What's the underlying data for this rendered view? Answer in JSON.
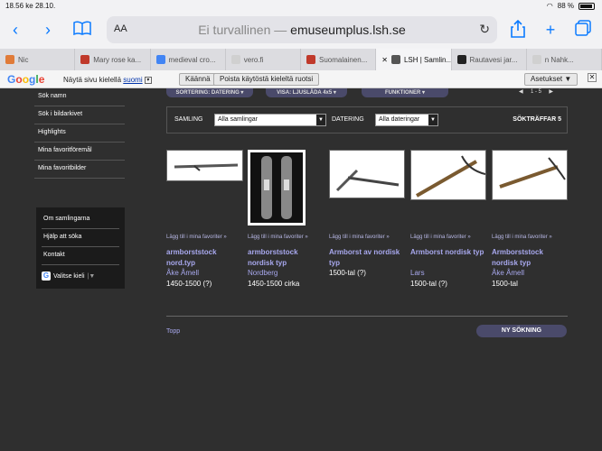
{
  "status": {
    "time": "18.56",
    "date": "ke 28.10.",
    "battery": "88 %"
  },
  "browser": {
    "aa": "AA",
    "insecure": "Ei turvallinen",
    "separator": " — ",
    "domain": "emuseumplus.lsh.se",
    "tabs": [
      {
        "label": "Nic",
        "color": "#e07b39"
      },
      {
        "label": "Mary rose ka...",
        "color": "#c0392b"
      },
      {
        "label": "medieval cro...",
        "color": "#4285f4"
      },
      {
        "label": "vero.fi",
        "color": "#d0d0d0"
      },
      {
        "label": "Suomalainen...",
        "color": "#c0392b"
      },
      {
        "label": "LSH | Samlin...",
        "color": "#555555",
        "active": true
      },
      {
        "label": "Rautavesi jar...",
        "color": "#222222"
      },
      {
        "label": "n Nahk...",
        "color": "#d0d0d0"
      }
    ]
  },
  "translate": {
    "logo": "Google",
    "prompt": "Näytä sivu kielellä",
    "language": "suomi",
    "translate_btn": "Käännä",
    "never_btn": "Poista käytöstä kieleltä ruotsi",
    "settings_btn": "Asetukset ▼"
  },
  "sidebar": {
    "items": [
      "Sök namn",
      "Sök i bildarkivet",
      "Highlights",
      "Mina favoritföremål",
      "Mina favoritbilder"
    ],
    "items2": [
      "Om samlingarna",
      "Hjälp att söka",
      "Kontakt"
    ],
    "language": "Valitse kieli"
  },
  "sortbar": {
    "sort": "SORTERING: DATERING ▾",
    "view": "VISA: LJUSLÅDA 4x5 ▾",
    "functions": "FUNKTIONER ▾",
    "pager": "1 - 5"
  },
  "filter": {
    "samling_label": "SAMLING",
    "samling_value": "Alla samlingar",
    "datering_label": "DATERING",
    "datering_value": "Alla dateringar",
    "hits_label": "SÖKTRÄFFAR",
    "hits": "5"
  },
  "results": [
    {
      "fav": "Lägg till i mina favoriter »",
      "title": "armborststock nord.typ",
      "artist": "Åke Åmell",
      "date": "1450-1500 (?)"
    },
    {
      "fav": "Lägg till i mina favoriter »",
      "title": "armborststock nordisk typ",
      "artist": "Nordberg",
      "date": "1450-1500 cirka"
    },
    {
      "fav": "Lägg till i mina favoriter »",
      "title": "Armborst av nordisk typ",
      "artist": "",
      "date": "1500-tal (?)"
    },
    {
      "fav": "Lägg till i mina favoriter »",
      "title": "Armborst nordisk typ",
      "artist": "Lars",
      "date": "1500-tal (?)"
    },
    {
      "fav": "Lägg till i mina favoriter »",
      "title": "Armborststock nordisk typ",
      "artist": "Åke Åmell",
      "date": "1500-tal"
    }
  ],
  "footer": {
    "top": "Topp",
    "new_search": "NY SÖKNING"
  }
}
